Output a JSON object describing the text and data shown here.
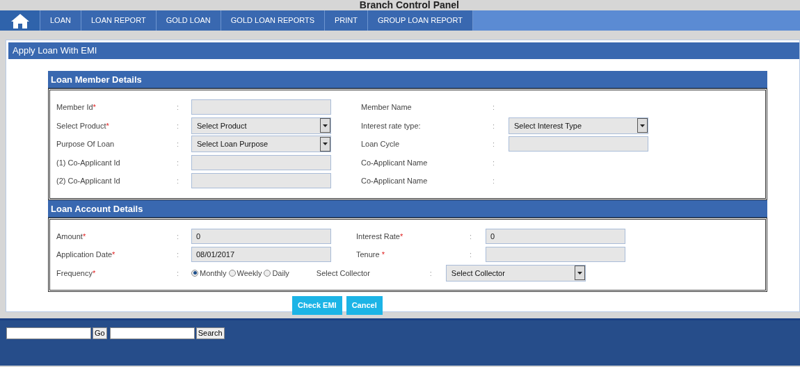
{
  "window": {
    "title": "Branch Control Panel"
  },
  "nav": {
    "items": [
      "LOAN",
      "LOAN REPORT",
      "GOLD LOAN",
      "GOLD LOAN REPORTS",
      "PRINT",
      "GROUP LOAN REPORT"
    ]
  },
  "page_title": "Apply Loan With EMI",
  "sections": [
    {
      "title": "Loan Member Details",
      "rows": [
        [
          {
            "label": "Member Id",
            "required_mark": "*",
            "separator": ":",
            "kind": "text"
          },
          {
            "label": "Member Name",
            "separator": ":",
            "kind": "none"
          }
        ],
        [
          {
            "label": "Select Product",
            "required_mark": "*",
            "separator": ":",
            "kind": "select",
            "value": "Select Product"
          },
          {
            "label": "Interest rate type:",
            "separator": ":",
            "kind": "select",
            "value": "Select Interest Type"
          }
        ],
        [
          {
            "label": "Purpose Of Loan",
            "separator": ":",
            "kind": "select",
            "value": "Select Loan Purpose"
          },
          {
            "label": "Loan Cycle",
            "separator": ":",
            "kind": "text"
          }
        ],
        [
          {
            "label": "(1) Co-Applicant Id",
            "separator": ":",
            "kind": "text"
          },
          {
            "label": "Co-Applicant Name",
            "separator": ":",
            "kind": "none"
          }
        ],
        [
          {
            "label": "(2) Co-Applicant Id",
            "separator": ":",
            "kind": "text"
          },
          {
            "label": "Co-Applicant Name",
            "separator": ":",
            "kind": "none"
          }
        ]
      ]
    },
    {
      "title": "Loan Account Details",
      "rows": [
        [
          {
            "label": "Amount",
            "required_mark": "*",
            "separator": ":",
            "kind": "text",
            "value": "0"
          },
          {
            "label": "Interest Rate",
            "required_mark": "*",
            "separator": ":",
            "kind": "text",
            "value": "0"
          }
        ],
        [
          {
            "label": "Application Date",
            "required_mark": "*",
            "separator": ":",
            "kind": "text",
            "value": "08/01/2017"
          },
          {
            "label": "Tenure",
            "required_mark": "*",
            "separator": ":",
            "kind": "text"
          }
        ],
        [
          {
            "label": "Frequency",
            "required_mark": "*",
            "separator": ":",
            "kind": "radio",
            "options": [
              {
                "label": "Monthly",
                "selected": true
              },
              {
                "label": "Weekly",
                "selected": false
              },
              {
                "label": "Daily",
                "selected": false
              }
            ]
          },
          {
            "label": "Select Collector",
            "separator": ":",
            "kind": "select",
            "value": "Select Collector"
          }
        ]
      ]
    }
  ],
  "buttons": [
    "Check EMI",
    "Cancel"
  ],
  "footer": {
    "go_button": "Go",
    "search_button": "Search"
  }
}
